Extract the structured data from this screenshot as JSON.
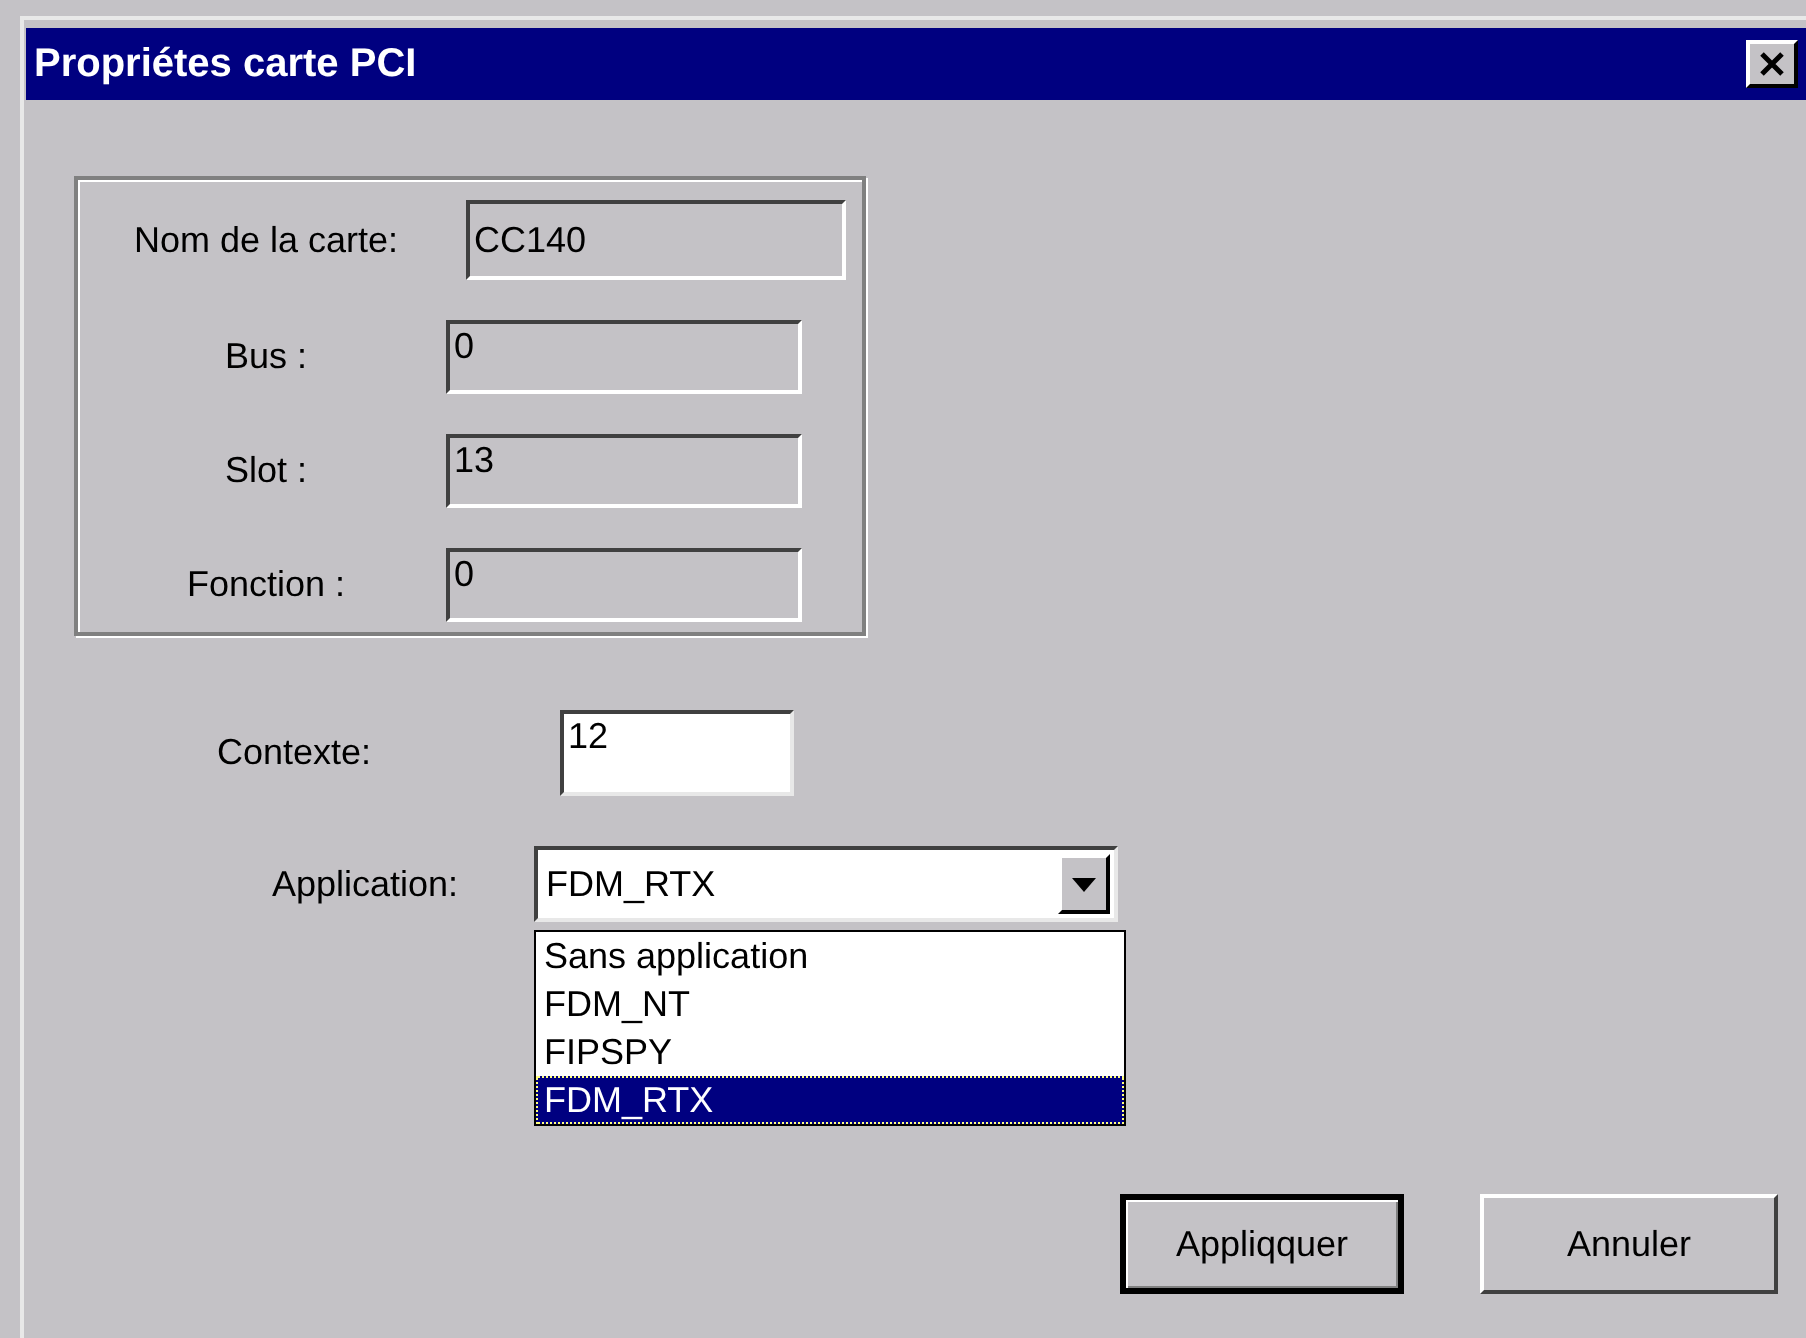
{
  "window": {
    "title": "Propriétes carte PCI"
  },
  "card_group": {
    "fields": [
      {
        "label": "Nom de la carte:",
        "value": "CC140"
      },
      {
        "label": "Bus :",
        "value": "0"
      },
      {
        "label": "Slot :",
        "value": "13"
      },
      {
        "label": "Fonction :",
        "value": "0"
      }
    ]
  },
  "contexte": {
    "label": "Contexte:",
    "value": "12"
  },
  "application": {
    "label": "Application:",
    "value": "FDM_RTX",
    "expanded": true,
    "options": [
      {
        "label": "Sans application",
        "selected": false
      },
      {
        "label": "FDM_NT",
        "selected": false
      },
      {
        "label": "FIPSPY",
        "selected": false
      },
      {
        "label": "FDM_RTX",
        "selected": true
      }
    ]
  },
  "buttons": [
    {
      "label": "Appliqquer",
      "default": true
    },
    {
      "label": "Annuler",
      "default": false
    }
  ]
}
